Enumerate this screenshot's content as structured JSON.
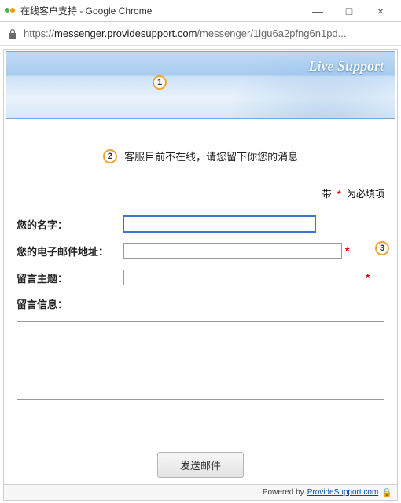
{
  "window": {
    "title": "在线客户支持 - Google Chrome",
    "controls": {
      "min": "—",
      "max": "□",
      "close": "×"
    }
  },
  "address": {
    "scheme": "https://",
    "host": "messenger.providesupport.com",
    "path": "/messenger/1lgu6a2pfng6n1pd..."
  },
  "banner": {
    "brand": "Live Support"
  },
  "annotations": {
    "a1": "1",
    "a2": "2",
    "a3": "3"
  },
  "notice": "客服目前不在线，请您留下你您的消息",
  "required_note": {
    "prefix": "带",
    "star": "*",
    "suffix": "为必填项"
  },
  "fields": {
    "name": {
      "label": "您的名字：",
      "value": ""
    },
    "email": {
      "label": "您的电子邮件地址：",
      "value": ""
    },
    "subject": {
      "label": "留言主题：",
      "value": ""
    },
    "message": {
      "label": "留言信息：",
      "value": ""
    }
  },
  "submit": "发送邮件",
  "footer": {
    "powered": "Powered by",
    "link": "ProvideSupport.com"
  }
}
